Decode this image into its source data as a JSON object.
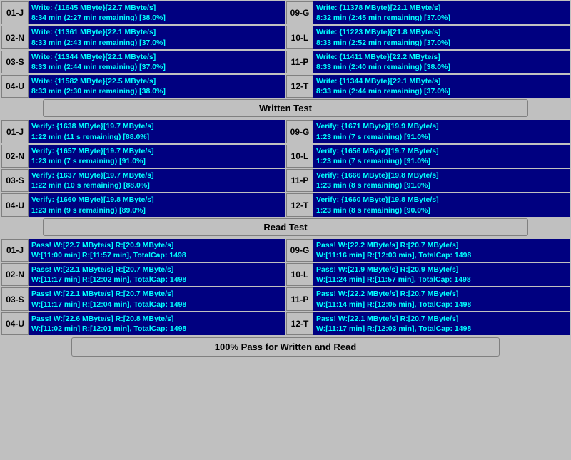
{
  "sections": {
    "write": {
      "rows": [
        {
          "left": {
            "id": "01-J",
            "line1": "Write: {11645 MByte}[22.7 MByte/s]",
            "line2": "8:34 min (2:27 min remaining)  [38.0%]"
          },
          "right": {
            "id": "09-G",
            "line1": "Write: {11378 MByte}[22.1 MByte/s]",
            "line2": "8:32 min (2:45 min remaining)  [37.0%]"
          }
        },
        {
          "left": {
            "id": "02-N",
            "line1": "Write: {11361 MByte}[22.1 MByte/s]",
            "line2": "8:33 min (2:43 min remaining)  [37.0%]"
          },
          "right": {
            "id": "10-L",
            "line1": "Write: {11223 MByte}[21.8 MByte/s]",
            "line2": "8:33 min (2:52 min remaining)  [37.0%]"
          }
        },
        {
          "left": {
            "id": "03-S",
            "line1": "Write: {11344 MByte}[22.1 MByte/s]",
            "line2": "8:33 min (2:44 min remaining)  [37.0%]"
          },
          "right": {
            "id": "11-P",
            "line1": "Write: {11411 MByte}[22.2 MByte/s]",
            "line2": "8:33 min (2:40 min remaining)  [38.0%]"
          }
        },
        {
          "left": {
            "id": "04-U",
            "line1": "Write: {11582 MByte}[22.5 MByte/s]",
            "line2": "8:33 min (2:30 min remaining)  [38.0%]"
          },
          "right": {
            "id": "12-T",
            "line1": "Write: {11344 MByte}[22.1 MByte/s]",
            "line2": "8:33 min (2:44 min remaining)  [37.0%]"
          }
        }
      ]
    },
    "written_header": "Written Test",
    "verify": {
      "rows": [
        {
          "left": {
            "id": "01-J",
            "line1": "Verify: {1638 MByte}[19.7 MByte/s]",
            "line2": "1:22 min (11 s remaining)   [88.0%]"
          },
          "right": {
            "id": "09-G",
            "line1": "Verify: {1671 MByte}[19.9 MByte/s]",
            "line2": "1:23 min (7 s remaining)   [91.0%]"
          }
        },
        {
          "left": {
            "id": "02-N",
            "line1": "Verify: {1657 MByte}[19.7 MByte/s]",
            "line2": "1:23 min (7 s remaining)   [91.0%]"
          },
          "right": {
            "id": "10-L",
            "line1": "Verify: {1656 MByte}[19.7 MByte/s]",
            "line2": "1:23 min (7 s remaining)   [91.0%]"
          }
        },
        {
          "left": {
            "id": "03-S",
            "line1": "Verify: {1637 MByte}[19.7 MByte/s]",
            "line2": "1:22 min (10 s remaining)   [88.0%]"
          },
          "right": {
            "id": "11-P",
            "line1": "Verify: {1666 MByte}[19.8 MByte/s]",
            "line2": "1:23 min (8 s remaining)   [91.0%]"
          }
        },
        {
          "left": {
            "id": "04-U",
            "line1": "Verify: {1660 MByte}[19.8 MByte/s]",
            "line2": "1:23 min (9 s remaining)   [89.0%]"
          },
          "right": {
            "id": "12-T",
            "line1": "Verify: {1660 MByte}[19.8 MByte/s]",
            "line2": "1:23 min (8 s remaining)   [90.0%]"
          }
        }
      ]
    },
    "read_header": "Read Test",
    "pass": {
      "rows": [
        {
          "left": {
            "id": "01-J",
            "line1": "Pass! W:[22.7 MByte/s] R:[20.9 MByte/s]",
            "line2": "W:[11:00 min] R:[11:57 min], TotalCap: 1498"
          },
          "right": {
            "id": "09-G",
            "line1": "Pass! W:[22.2 MByte/s] R:[20.7 MByte/s]",
            "line2": "W:[11:16 min] R:[12:03 min], TotalCap: 1498"
          }
        },
        {
          "left": {
            "id": "02-N",
            "line1": "Pass! W:[22.1 MByte/s] R:[20.7 MByte/s]",
            "line2": "W:[11:17 min] R:[12:02 min], TotalCap: 1498"
          },
          "right": {
            "id": "10-L",
            "line1": "Pass! W:[21.9 MByte/s] R:[20.9 MByte/s]",
            "line2": "W:[11:24 min] R:[11:57 min], TotalCap: 1498"
          }
        },
        {
          "left": {
            "id": "03-S",
            "line1": "Pass! W:[22.1 MByte/s] R:[20.7 MByte/s]",
            "line2": "W:[11:17 min] R:[12:04 min], TotalCap: 1498"
          },
          "right": {
            "id": "11-P",
            "line1": "Pass! W:[22.2 MByte/s] R:[20.7 MByte/s]",
            "line2": "W:[11:14 min] R:[12:05 min], TotalCap: 1498"
          }
        },
        {
          "left": {
            "id": "04-U",
            "line1": "Pass! W:[22.6 MByte/s] R:[20.8 MByte/s]",
            "line2": "W:[11:02 min] R:[12:01 min], TotalCap: 1498"
          },
          "right": {
            "id": "12-T",
            "line1": "Pass! W:[22.1 MByte/s] R:[20.7 MByte/s]",
            "line2": "W:[11:17 min] R:[12:03 min], TotalCap: 1498"
          }
        }
      ]
    },
    "bottom_bar": "100% Pass for Written and Read"
  }
}
